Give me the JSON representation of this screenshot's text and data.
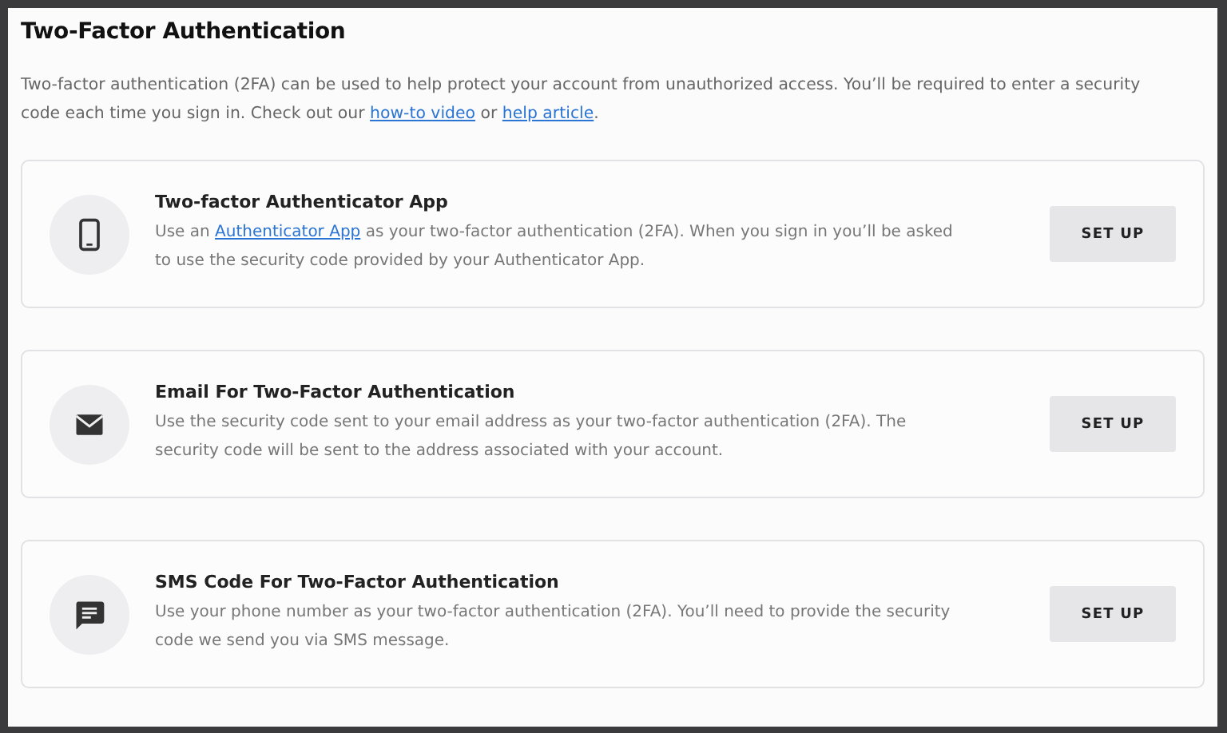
{
  "title": "Two-Factor Authentication",
  "intro": [
    {
      "kind": "text",
      "text": "Two-factor authentication (2FA) can be used to help protect your account from unauthorized access. You’ll be required to enter a security code each time you sign in. Check out our "
    },
    {
      "kind": "link",
      "text": "how-to video"
    },
    {
      "kind": "text",
      "text": " or "
    },
    {
      "kind": "link",
      "text": "help article"
    },
    {
      "kind": "text",
      "text": "."
    }
  ],
  "methods": [
    {
      "kind": "phone",
      "title": "Two-factor Authenticator App",
      "description": [
        {
          "kind": "text",
          "text": "Use an "
        },
        {
          "kind": "link",
          "text": "Authenticator App"
        },
        {
          "kind": "text",
          "text": " as your two-factor authentication (2FA). When you sign in you’ll be asked to use the security code provided by your Authenticator App."
        }
      ],
      "button": "SET UP"
    },
    {
      "kind": "email",
      "title": "Email For Two-Factor Authentication",
      "description": [
        {
          "kind": "text",
          "text": "Use the security code sent to your email address as your two-factor authentication (2FA). The security code will be sent to the address associated with your account."
        }
      ],
      "button": "SET UP"
    },
    {
      "kind": "message",
      "title": "SMS Code For Two-Factor Authentication",
      "description": [
        {
          "kind": "text",
          "text": "Use your phone number as your two-factor authentication (2FA). You’ll need to provide the security code we send you via SMS message."
        }
      ],
      "button": "SET UP"
    }
  ]
}
